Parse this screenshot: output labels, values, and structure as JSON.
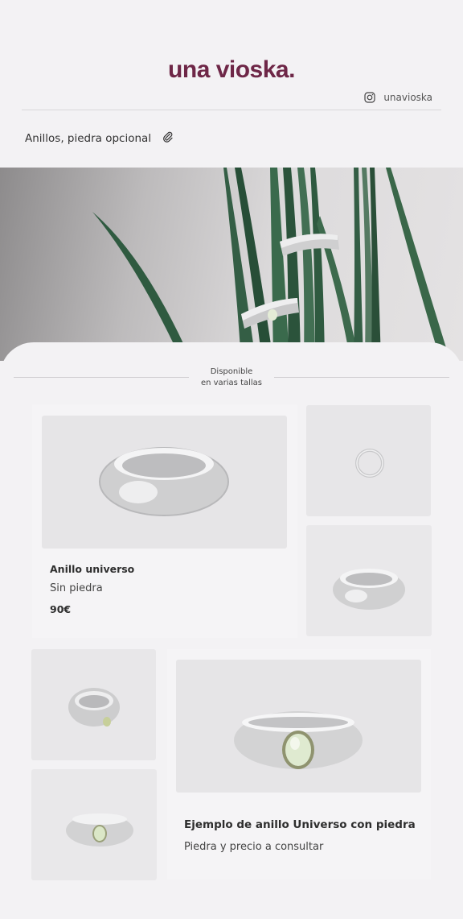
{
  "header": {
    "brand": "una vioska.",
    "instagram_handle": "unavioska",
    "instagram_icon": "instagram-icon"
  },
  "collection": {
    "title": "Anillos, piedra opcional",
    "icon": "paperclip-icon"
  },
  "availability": {
    "line1": "Disponible",
    "line2": "en varias tallas"
  },
  "products": [
    {
      "title": "Anillo universo",
      "subtitle": "Sin piedra",
      "price": "90€"
    },
    {
      "title": "Ejemplo de anillo Universo con piedra",
      "subtitle": "Piedra y precio a consultar"
    }
  ],
  "colors": {
    "brand": "#6e2747",
    "background": "#f3f2f4",
    "plant": "#2f5a40",
    "silver": "#d9d9d9",
    "opal": "#d8e6c4"
  }
}
